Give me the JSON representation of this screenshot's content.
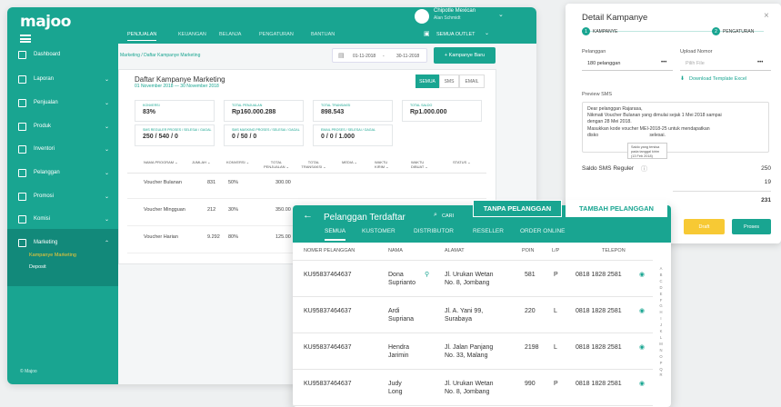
{
  "app": {
    "logo": "majoo",
    "copyright": "© Majoo"
  },
  "sidebar": {
    "items": [
      {
        "label": "Dashboard",
        "chevron": ""
      },
      {
        "label": "Laporan",
        "chevron": "⌄"
      },
      {
        "label": "Penjualan",
        "chevron": "⌄"
      },
      {
        "label": "Produk",
        "chevron": "⌄"
      },
      {
        "label": "Inventori",
        "chevron": "⌄"
      },
      {
        "label": "Pelanggan",
        "chevron": "⌄"
      },
      {
        "label": "Promosi",
        "chevron": "⌄"
      },
      {
        "label": "Komisi",
        "chevron": "⌄"
      },
      {
        "label": "Marketing",
        "chevron": "⌃"
      }
    ],
    "sub": [
      "Kampanye Marketing",
      "Deposit"
    ]
  },
  "topnav": {
    "items": [
      "PENJUALAN",
      "KEUANGAN",
      "BELANJA",
      "PENGATURAN",
      "BANTUAN"
    ],
    "outlet": "SEMUA OUTLET"
  },
  "user": {
    "name": "Chipotle Mexican",
    "sub": "Alan Schmidt"
  },
  "page": {
    "breadcrumb": "Marketing / Daftar Kampanye Marketing",
    "date_from": "01-11-2018",
    "date_sep": "-",
    "date_to": "30-11-2018",
    "add_button": "+ Kampanye Baru",
    "title": "Daftar Kampanye Marketing",
    "subtitle": "01 November 2018 — 30 November 2018",
    "segments": [
      "SEMUA",
      "SMS",
      "EMAIL"
    ],
    "stats": [
      {
        "label": "KONVERSI",
        "value": "83%"
      },
      {
        "label": "TOTAL PENJUALAN",
        "value": "Rp160.000.288"
      },
      {
        "label": "TOTAL TRANSAKSI",
        "value": "898.543"
      },
      {
        "label": "TOTAL SALDO",
        "value": "Rp1.000.000"
      },
      {
        "label": "SMS REGULER PROSES / SELESAI / GAGAL",
        "value": "250 / 540 / 0"
      },
      {
        "label": "SMS MASKING PROSES / SELESAI / GAGAL",
        "value": "0 / 50 / 0"
      },
      {
        "label": "EMAIL PROSES / SELESAI / GAGAL",
        "value": "0 / 0 / 1.000"
      }
    ],
    "table_headers": [
      "NAMA PROGRAM ⌄",
      "JUMLAH ⌄",
      "KONVERSI ⌄",
      "TOTAL PENJUALAN ⌄",
      "TOTAL TRANSAKSI ⌄",
      "MEDIA ⌄",
      "WAKTU KIRIM ⌄",
      "WAKTU DIBUAT ⌄",
      "STATUS ⌄"
    ],
    "rows": [
      {
        "name": "Voucher Bulanan",
        "jumlah": "831",
        "konversi": "50%",
        "total": "300.00"
      },
      {
        "name": "Voucher Mingguan",
        "jumlah": "212",
        "konversi": "30%",
        "total": "350.00"
      },
      {
        "name": "Voucher Harian",
        "jumlah": "9.292",
        "konversi": "80%",
        "total": "125.00"
      }
    ]
  },
  "detail": {
    "title": "Detail Kampanye",
    "close": "×",
    "steps": [
      {
        "num": "1",
        "label": "KAMPANYE"
      },
      {
        "num": "2",
        "label": "PENGATURAN"
      }
    ],
    "pelanggan_label": "Pelanggan",
    "pelanggan_value": "180 pelanggan",
    "upload_label": "Upload Nomor",
    "upload_placeholder": "Pilih File",
    "more": "•••",
    "download": "Download Template Excel",
    "preview_label": "Preview SMS",
    "sms_lines": [
      "Dear pelanggan Rajarasa,",
      "Nikmati Voucher Bulanan yang dimulai sejak 1 Mei 2018 sampai",
      "dengan 28 Mei 2018.",
      "Masukkan kode voucher MEI-2018-25 untuk mendapatkan",
      "disko                                       selesai."
    ],
    "tooltip": "Saldo yang tersisa pada tanggal kirim (13 Feb 2018)",
    "saldo_label": "Saldo SMS Reguler",
    "saldo_value": "250",
    "saldo_used": "19",
    "saldo_rest": "231",
    "draft": "Draft",
    "proses": "Proses"
  },
  "customers": {
    "title": "Pelanggan Terdaftar",
    "back": "←",
    "search": "CARI",
    "btn_tanpa": "TANPA PELANGGAN",
    "btn_tambah": "TAMBAH PELANGGAN",
    "tabs": [
      "SEMUA",
      "KUSTOMER",
      "DISTRIBUTOR",
      "RESELLER",
      "ORDER ONLINE"
    ],
    "headers": [
      "NOMER PELANGGAN",
      "NAMA",
      "ALAMAT",
      "POIN",
      "L/P",
      "TELEPON"
    ],
    "rows": [
      {
        "no": "KU95837464637",
        "name1": "Dona",
        "name2": "Suprianto",
        "addr1": "Jl. Urukan Wetan",
        "addr2": "No. 8, Jombang",
        "poin": "581",
        "lp": "P",
        "tel": "0818 1828 2581"
      },
      {
        "no": "KU95837464637",
        "name1": "Ardi",
        "name2": "Supriana",
        "addr1": "Jl. A. Yani 99,",
        "addr2": "Surabaya",
        "poin": "220",
        "lp": "L",
        "tel": "0818 1828 2581"
      },
      {
        "no": "KU95837464637",
        "name1": "Hendra",
        "name2": "Jarimin",
        "addr1": "Jl. Jalan Panjang",
        "addr2": "No. 33, Malang",
        "poin": "2198",
        "lp": "L",
        "tel": "0818 1828 2581"
      },
      {
        "no": "KU95837464637",
        "name1": "Judy",
        "name2": "Long",
        "addr1": "Jl. Urukan Wetan",
        "addr2": "No. 8, Jombang",
        "poin": "990",
        "lp": "P",
        "tel": "0818 1828 2581"
      }
    ],
    "alphabet": "A B C D E F G H I J K L M N O P Q R"
  },
  "colors": {
    "brand": "#19a591",
    "brand_dark": "#12897a",
    "draft": "#f7c934"
  }
}
